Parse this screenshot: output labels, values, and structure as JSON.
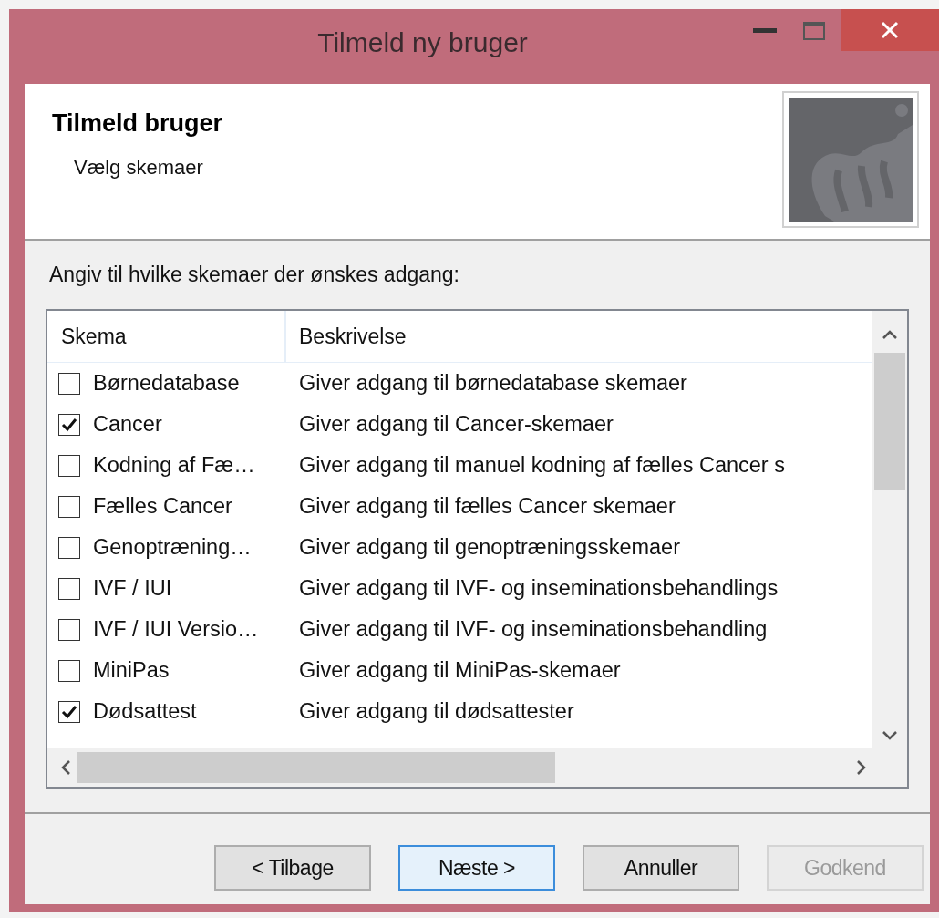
{
  "window": {
    "title": "Tilmeld ny bruger"
  },
  "header": {
    "title": "Tilmeld bruger",
    "subtitle": "Vælg skemaer"
  },
  "prompt": "Angiv til hvilke skemaer der ønskes adgang:",
  "table": {
    "columns": [
      "Skema",
      "Beskrivelse"
    ],
    "rows": [
      {
        "name": "Børnedatabase",
        "description": "Giver adgang til børnedatabase skemaer",
        "checked": false
      },
      {
        "name": "Cancer",
        "description": "Giver adgang til Cancer-skemaer",
        "checked": true
      },
      {
        "name": "Kodning af Fæ…",
        "description": "Giver adgang til manuel kodning af fælles Cancer s",
        "checked": false
      },
      {
        "name": "Fælles Cancer",
        "description": "Giver adgang til fælles Cancer skemaer",
        "checked": false
      },
      {
        "name": "Genoptræning…",
        "description": "Giver adgang til genoptræningsskemaer",
        "checked": false
      },
      {
        "name": "IVF / IUI",
        "description": "Giver adgang til IVF- og inseminationsbehandlings",
        "checked": false
      },
      {
        "name": "IVF / IUI Versio…",
        "description": "Giver adgang til IVF- og inseminationsbehandling",
        "checked": false
      },
      {
        "name": "MiniPas",
        "description": "Giver adgang til MiniPas-skemaer",
        "checked": false
      },
      {
        "name": "Dødsattest",
        "description": "Giver adgang til dødsattester",
        "checked": true
      }
    ]
  },
  "buttons": [
    {
      "label": "< Tilbage",
      "disabled": false,
      "default": false
    },
    {
      "label": "Næste >",
      "disabled": false,
      "default": true
    },
    {
      "label": "Annuller",
      "disabled": false,
      "default": false
    },
    {
      "label": "Godkend",
      "disabled": true,
      "default": false
    }
  ]
}
